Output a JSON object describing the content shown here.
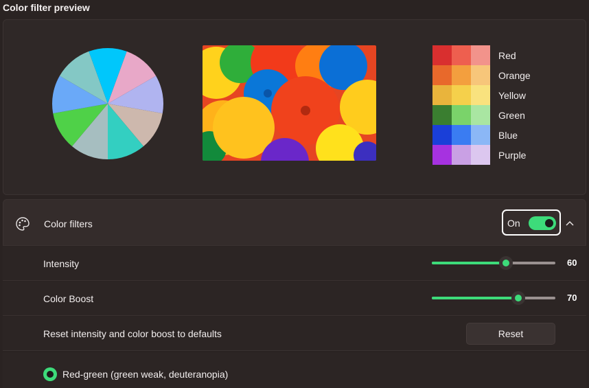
{
  "section_title": "Color filter preview",
  "preview": {
    "pie_colors": [
      "#00c7fb",
      "#e8a8c8",
      "#b0b4f0",
      "#cdb8ad",
      "#33cfc1",
      "#a6bec0",
      "#4fd148",
      "#6aa9f8",
      "#84c8c5"
    ],
    "photo_alt": "colorful paper fans",
    "swatches": [
      {
        "label": "Red",
        "colors": [
          "#d92f2f",
          "#ee5f4f",
          "#f2938b"
        ]
      },
      {
        "label": "Orange",
        "colors": [
          "#e8692b",
          "#f39f3e",
          "#f7c67a"
        ]
      },
      {
        "label": "Yellow",
        "colors": [
          "#e9b43c",
          "#f5d04b",
          "#f9e27e"
        ]
      },
      {
        "label": "Green",
        "colors": [
          "#3a7e30",
          "#7ad36a",
          "#a9e6a2"
        ]
      },
      {
        "label": "Blue",
        "colors": [
          "#1a3fd8",
          "#3a7cf2",
          "#8bb7f6"
        ]
      },
      {
        "label": "Purple",
        "colors": [
          "#a632e0",
          "#c9a0e4",
          "#dcc7ef"
        ]
      }
    ]
  },
  "filters": {
    "label": "Color filters",
    "toggle_text": "On",
    "toggle_on": true,
    "accent": "#3ddb7a"
  },
  "intensity": {
    "label": "Intensity",
    "value": 60,
    "display": "60"
  },
  "boost": {
    "label": "Color Boost",
    "value": 70,
    "display": "70"
  },
  "reset": {
    "label": "Reset intensity and color boost to defaults",
    "button": "Reset"
  },
  "option": {
    "label": "Red-green (green weak, deuteranopia)",
    "selected": true
  }
}
